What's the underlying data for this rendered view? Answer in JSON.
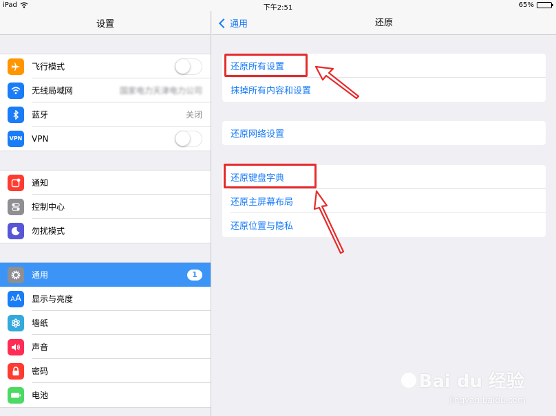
{
  "status_bar": {
    "device": "iPad",
    "time": "下午2:51",
    "battery": "65%",
    "battery_level": 0.65
  },
  "sidebar": {
    "title": "设置",
    "groups": [
      [
        {
          "label": "飞行模式",
          "icon": "airplane-icon",
          "color": "#ff9500",
          "control": "switch",
          "on": false
        },
        {
          "label": "无线局域网",
          "icon": "wifi-icon",
          "color": "#1a7cf7",
          "value": "国家电力天津电力公司"
        },
        {
          "label": "蓝牙",
          "icon": "bluetooth-icon",
          "color": "#1a7cf7",
          "value": "关闭"
        },
        {
          "label": "VPN",
          "icon": "vpn-icon",
          "color": "#1a7cf7",
          "control": "switch",
          "on": false
        }
      ],
      [
        {
          "label": "通知",
          "icon": "notification-icon",
          "color": "#ff3b30"
        },
        {
          "label": "控制中心",
          "icon": "control-center-icon",
          "color": "#8e8e93"
        },
        {
          "label": "勿扰模式",
          "icon": "moon-icon",
          "color": "#5856d6"
        }
      ],
      [
        {
          "label": "通用",
          "icon": "gear-icon",
          "color": "#8e8e93",
          "badge": "1",
          "selected": true
        },
        {
          "label": "显示与亮度",
          "icon": "brightness-icon",
          "color": "#1a7cf7"
        },
        {
          "label": "墙纸",
          "icon": "wallpaper-icon",
          "color": "#34aadc"
        },
        {
          "label": "声音",
          "icon": "speaker-icon",
          "color": "#ff2d55"
        },
        {
          "label": "密码",
          "icon": "lock-icon",
          "color": "#ff3b30"
        },
        {
          "label": "电池",
          "icon": "battery-icon",
          "color": "#4cd964"
        }
      ]
    ]
  },
  "detail": {
    "back_label": "通用",
    "title": "还原",
    "groups": [
      [
        "还原所有设置",
        "抹掉所有内容和设置"
      ],
      [
        "还原网络设置"
      ],
      [
        "还原键盘字典",
        "还原主屏幕布局",
        "还原位置与隐私"
      ]
    ]
  },
  "annotation_color": "#e62b2b",
  "watermark": {
    "brand": "Bai du 经验",
    "site": "jingyan.baidu.com"
  }
}
